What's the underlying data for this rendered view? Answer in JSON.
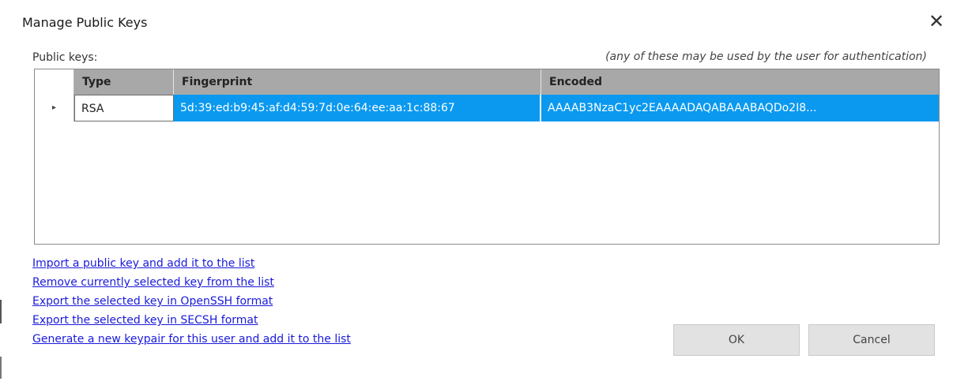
{
  "window": {
    "title": "Manage Public Keys",
    "close_icon": "close-icon"
  },
  "keys_label": "Public keys:",
  "hint": "(any of these may be used by the user for authentication)",
  "table": {
    "columns": [
      "Type",
      "Fingerprint",
      "Encoded"
    ],
    "rows": [
      {
        "indicator": "▸",
        "type": "RSA",
        "fingerprint": "5d:39:ed:b9:45:af:d4:59:7d:0e:64:ee:aa:1c:88:67",
        "encoded": "AAAAB3NzaC1yc2EAAAADAQABAAABAQDo2I8..."
      }
    ],
    "selected_color": "#0b99f0"
  },
  "links": [
    "Import a public key and add it to the list",
    "Remove currently selected key from the list",
    "Export the selected key in OpenSSH format",
    "Export the selected key in SECSH format",
    "Generate a new keypair for this user and add it to the list"
  ],
  "buttons": {
    "ok": "OK",
    "cancel": "Cancel"
  }
}
